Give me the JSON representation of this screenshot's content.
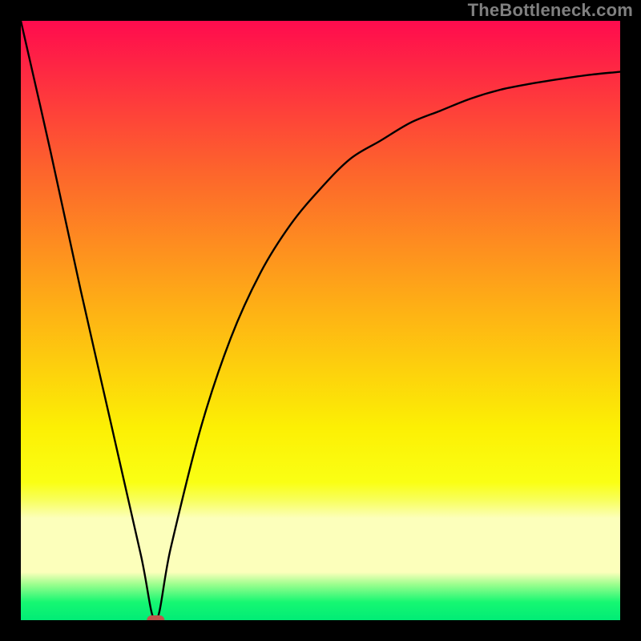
{
  "attribution": "TheBottleneck.com",
  "chart_data": {
    "type": "line",
    "title": "",
    "xlabel": "",
    "ylabel": "",
    "xlim": [
      0,
      100
    ],
    "ylim": [
      0,
      100
    ],
    "minimum_x": 22.5,
    "minimum_y": 0,
    "marker": {
      "x": 22.5,
      "y": 0,
      "color": "#c1554d"
    },
    "background_gradient": [
      {
        "stop": 0.0,
        "color": "#ff0b4e"
      },
      {
        "stop": 0.25,
        "color": "#fd642c"
      },
      {
        "stop": 0.47,
        "color": "#fead16"
      },
      {
        "stop": 0.68,
        "color": "#fcf004"
      },
      {
        "stop": 0.77,
        "color": "#faff14"
      },
      {
        "stop": 0.8,
        "color": "#f8ff5d"
      },
      {
        "stop": 0.83,
        "color": "#fcffbb"
      },
      {
        "stop": 0.92,
        "color": "#fcffbb"
      },
      {
        "stop": 0.94,
        "color": "#9dfe8e"
      },
      {
        "stop": 0.97,
        "color": "#16f772"
      },
      {
        "stop": 1.0,
        "color": "#01ec76"
      }
    ],
    "series": [
      {
        "name": "curve",
        "x": [
          0,
          5,
          10,
          15,
          20,
          22.5,
          25,
          30,
          35,
          40,
          45,
          50,
          55,
          60,
          65,
          70,
          75,
          80,
          85,
          90,
          95,
          100
        ],
        "y": [
          100,
          78,
          55,
          33,
          11,
          0,
          12,
          32,
          47,
          58,
          66,
          72,
          77,
          80,
          83,
          85,
          87,
          88.5,
          89.5,
          90.3,
          91,
          91.5
        ]
      }
    ]
  }
}
